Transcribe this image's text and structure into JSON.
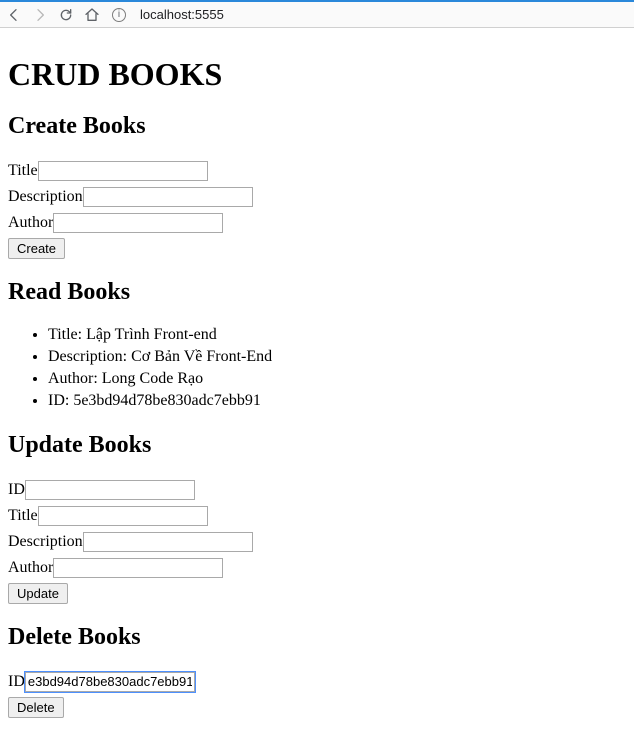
{
  "toolbar": {
    "address": "localhost:5555"
  },
  "page": {
    "title": "CRUD BOOKS"
  },
  "create": {
    "heading": "Create Books",
    "title_label": "Title",
    "title_value": "",
    "description_label": "Description",
    "description_value": "",
    "author_label": "Author",
    "author_value": "",
    "button": "Create"
  },
  "read": {
    "heading": "Read Books",
    "items": [
      "Title: Lập Trình Front-end",
      "Description: Cơ Bản Về Front-End",
      "Author: Long Code Rạo",
      "ID: 5e3bd94d78be830adc7ebb91"
    ]
  },
  "update": {
    "heading": "Update Books",
    "id_label": "ID",
    "id_value": "",
    "title_label": "Title",
    "title_value": "",
    "description_label": "Description",
    "description_value": "",
    "author_label": "Author",
    "author_value": "",
    "button": "Update"
  },
  "delete": {
    "heading": "Delete Books",
    "id_label": "ID",
    "id_value": "e3bd94d78be830adc7ebb91",
    "button": "Delete"
  }
}
